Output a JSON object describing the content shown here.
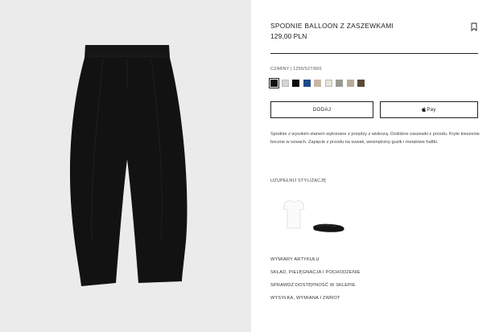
{
  "product": {
    "title": "SPODNIE BALLOON Z ZASZEWKAMI",
    "price": "129,00 PLN",
    "color_label": "CZARNY | 1255/527/800",
    "swatches": [
      {
        "name": "czarny",
        "color": "#111111",
        "selected": true
      },
      {
        "name": "jasnoszary",
        "color": "#d4d4d0"
      },
      {
        "name": "czarny-2",
        "color": "#0c0c0c"
      },
      {
        "name": "niebieski",
        "color": "#1f4a8a"
      },
      {
        "name": "bezowy",
        "color": "#c8b6a4"
      },
      {
        "name": "ecru",
        "color": "#e8e3d8"
      },
      {
        "name": "szary",
        "color": "#9a9a95"
      },
      {
        "name": "khaki",
        "color": "#b4ac98"
      },
      {
        "name": "brazowy",
        "color": "#5a4a3a"
      }
    ],
    "add_button": "DODAJ",
    "pay_button": "Pay",
    "description": "Spodnie z wysokim stanem wykonane z przędzy z wiskozą. Ozdobne zaszewki z przodu. Kryte kieszenie boczne w szwach. Zapięcie z przodu na suwak, wewnętrzny guzik i metalowe haftki."
  },
  "styling": {
    "label": "UZUPEŁNIJ STYLIZACJĘ",
    "items": [
      {
        "name": "t-shirt",
        "icon": "white-tshirt"
      },
      {
        "name": "baleriny",
        "icon": "black-ballet-flat"
      }
    ]
  },
  "links": [
    "WYMIARY ARTYKUŁU",
    "SKŁAD, PIELĘGNACJA I POCHODZENIE",
    "SPRAWDŹ DOSTĘPNOŚĆ W SKLEPIE",
    "WYSYŁKA, WYMIANA I ZWROT"
  ]
}
